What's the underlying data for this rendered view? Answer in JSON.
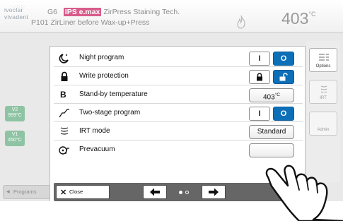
{
  "header": {
    "logo_line1": "ivoclar",
    "logo_line2": "vivadent",
    "furnace_label": "G6",
    "brand_badge": "IPS e.max",
    "program_title": "ZirPress Staining Tech.",
    "program_number": "P101",
    "program_subtitle": "ZirLiner before Wax-up+Press",
    "temperature_value": "403",
    "temperature_unit": "°C"
  },
  "background": {
    "v2_label": "V2",
    "v2_temp": "959°C",
    "v1_label": "V1",
    "v1_temp": "450°C",
    "programs_button": "Programs",
    "rail": {
      "options_label": "Options",
      "irt_label": "IRT",
      "admin_label": "Admin"
    }
  },
  "options": [
    {
      "icon": "night-program-icon",
      "label": "Night program",
      "control": "toggle",
      "on_label": "I",
      "off_label": "O",
      "selected": "off"
    },
    {
      "icon": "lock-icon",
      "label": "Write protection",
      "control": "toggle-lock",
      "selected": "unlocked"
    },
    {
      "icon": "standby-b-icon",
      "label": "Stand-by temperature",
      "control": "value",
      "value": "403",
      "unit": "°C"
    },
    {
      "icon": "two-stage-curve-icon",
      "label": "Two-stage program",
      "control": "toggle",
      "on_label": "I",
      "off_label": "O",
      "selected": "off"
    },
    {
      "icon": "irt-mode-icon",
      "label": "IRT mode",
      "control": "value",
      "value": "Standard"
    },
    {
      "icon": "prevacuum-icon",
      "label": "Prevacuum",
      "control": "value",
      "value": ""
    }
  ],
  "toolbar": {
    "close_label": "Close",
    "page_count": 2,
    "current_page": 1
  },
  "colors": {
    "accent_blue": "#0d6fb8",
    "brand_pink": "#d85c8a",
    "toolbar_gray": "#666666",
    "v_box_green": "#8ec3a4"
  },
  "icons": {
    "flame": "flame-icon",
    "prev": "arrow-left-icon",
    "next": "arrow-right-icon",
    "close": "close-icon",
    "hand": "pointing-hand-icon"
  }
}
